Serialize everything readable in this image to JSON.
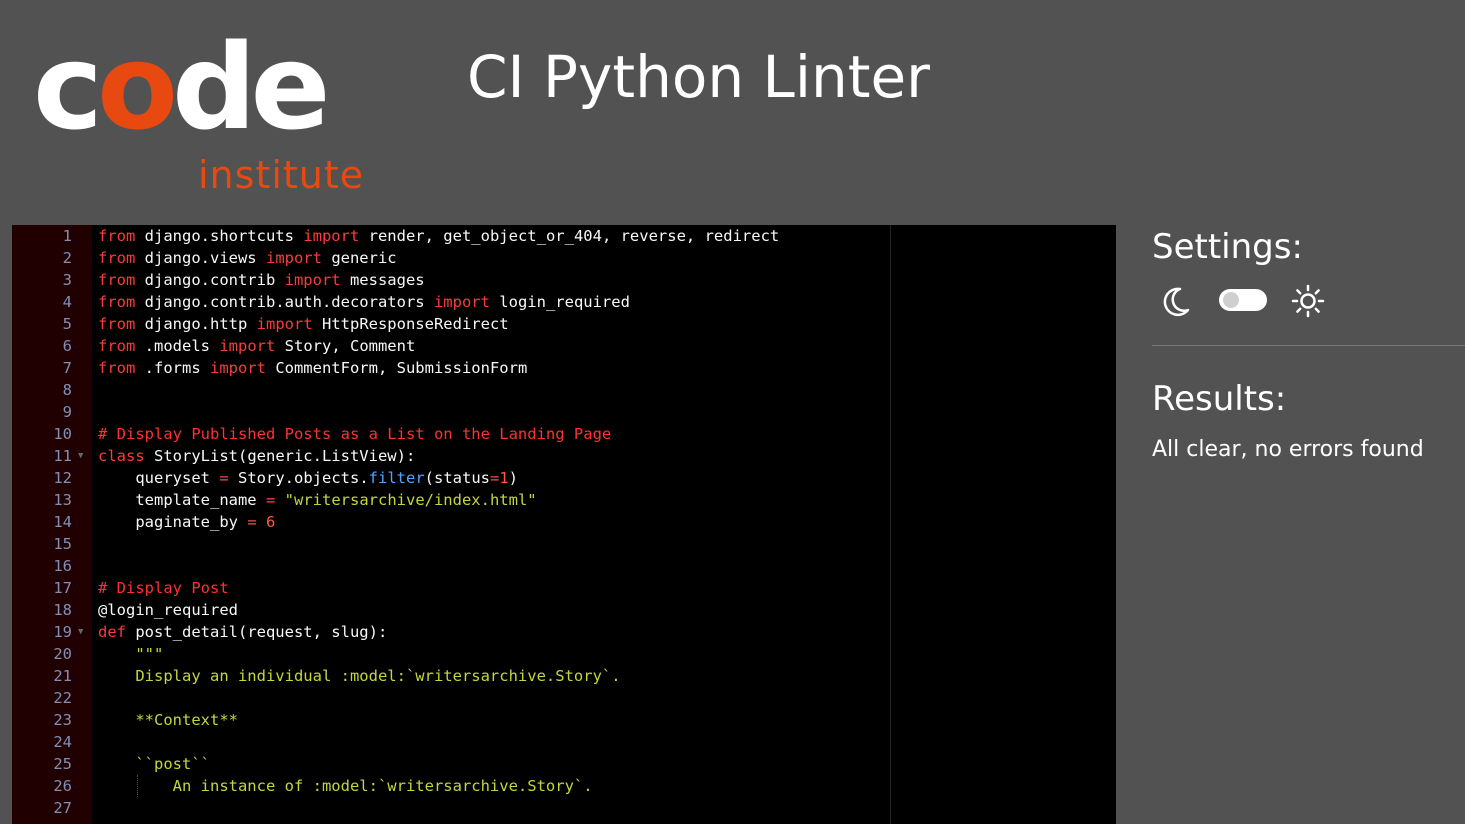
{
  "header": {
    "logo_word_c": "c",
    "logo_word_o": "o",
    "logo_word_de": "de",
    "logo_sub": "institute",
    "title": "CI Python Linter",
    "brand_orange": "#e84910"
  },
  "editor": {
    "lines": [
      {
        "n": "1",
        "fold": false,
        "tokens": [
          {
            "t": "kw",
            "v": "from"
          },
          {
            "t": "txt",
            "v": " django.shortcuts "
          },
          {
            "t": "kw",
            "v": "import"
          },
          {
            "t": "txt",
            "v": " render, get_object_or_404, reverse, redirect"
          }
        ]
      },
      {
        "n": "2",
        "fold": false,
        "tokens": [
          {
            "t": "kw",
            "v": "from"
          },
          {
            "t": "txt",
            "v": " django.views "
          },
          {
            "t": "kw",
            "v": "import"
          },
          {
            "t": "txt",
            "v": " generic"
          }
        ]
      },
      {
        "n": "3",
        "fold": false,
        "tokens": [
          {
            "t": "kw",
            "v": "from"
          },
          {
            "t": "txt",
            "v": " django.contrib "
          },
          {
            "t": "kw",
            "v": "import"
          },
          {
            "t": "txt",
            "v": " messages"
          }
        ]
      },
      {
        "n": "4",
        "fold": false,
        "tokens": [
          {
            "t": "kw",
            "v": "from"
          },
          {
            "t": "txt",
            "v": " django.contrib.auth.decorators "
          },
          {
            "t": "kw",
            "v": "import"
          },
          {
            "t": "txt",
            "v": " login_required"
          }
        ]
      },
      {
        "n": "5",
        "fold": false,
        "tokens": [
          {
            "t": "kw",
            "v": "from"
          },
          {
            "t": "txt",
            "v": " django.http "
          },
          {
            "t": "kw",
            "v": "import"
          },
          {
            "t": "txt",
            "v": " HttpResponseRedirect"
          }
        ]
      },
      {
        "n": "6",
        "fold": false,
        "tokens": [
          {
            "t": "kw",
            "v": "from"
          },
          {
            "t": "txt",
            "v": " .models "
          },
          {
            "t": "kw",
            "v": "import"
          },
          {
            "t": "txt",
            "v": " Story, Comment"
          }
        ]
      },
      {
        "n": "7",
        "fold": false,
        "tokens": [
          {
            "t": "kw",
            "v": "from"
          },
          {
            "t": "txt",
            "v": " .forms "
          },
          {
            "t": "kw",
            "v": "import"
          },
          {
            "t": "txt",
            "v": " CommentForm, SubmissionForm"
          }
        ]
      },
      {
        "n": "8",
        "fold": false,
        "tokens": []
      },
      {
        "n": "9",
        "fold": false,
        "tokens": []
      },
      {
        "n": "10",
        "fold": false,
        "tokens": [
          {
            "t": "cm",
            "v": "# Display Published Posts as a List on the Landing Page"
          }
        ]
      },
      {
        "n": "11",
        "fold": true,
        "tokens": [
          {
            "t": "kw",
            "v": "class"
          },
          {
            "t": "txt",
            "v": " StoryList(generic.ListView):"
          }
        ]
      },
      {
        "n": "12",
        "fold": false,
        "tokens": [
          {
            "t": "txt",
            "v": "    queryset "
          },
          {
            "t": "op",
            "v": "="
          },
          {
            "t": "txt",
            "v": " Story.objects."
          },
          {
            "t": "fn",
            "v": "filter"
          },
          {
            "t": "txt",
            "v": "(status"
          },
          {
            "t": "op",
            "v": "="
          },
          {
            "t": "num",
            "v": "1"
          },
          {
            "t": "txt",
            "v": ")"
          }
        ]
      },
      {
        "n": "13",
        "fold": false,
        "tokens": [
          {
            "t": "txt",
            "v": "    template_name "
          },
          {
            "t": "op",
            "v": "="
          },
          {
            "t": "txt",
            "v": " "
          },
          {
            "t": "str",
            "v": "\"writersarchive/index.html\""
          }
        ]
      },
      {
        "n": "14",
        "fold": false,
        "tokens": [
          {
            "t": "txt",
            "v": "    paginate_by "
          },
          {
            "t": "op",
            "v": "="
          },
          {
            "t": "txt",
            "v": " "
          },
          {
            "t": "num",
            "v": "6"
          }
        ]
      },
      {
        "n": "15",
        "fold": false,
        "tokens": []
      },
      {
        "n": "16",
        "fold": false,
        "tokens": []
      },
      {
        "n": "17",
        "fold": false,
        "tokens": [
          {
            "t": "cm",
            "v": "# Display Post"
          }
        ]
      },
      {
        "n": "18",
        "fold": false,
        "tokens": [
          {
            "t": "txt",
            "v": "@login_required"
          }
        ]
      },
      {
        "n": "19",
        "fold": true,
        "tokens": [
          {
            "t": "kw",
            "v": "def"
          },
          {
            "t": "txt",
            "v": " post_detail(request, slug):"
          }
        ]
      },
      {
        "n": "20",
        "fold": false,
        "tokens": [
          {
            "t": "str",
            "v": "    \"\"\""
          }
        ]
      },
      {
        "n": "21",
        "fold": false,
        "tokens": [
          {
            "t": "str",
            "v": "    Display an individual :model:`writersarchive.Story`."
          }
        ]
      },
      {
        "n": "22",
        "fold": false,
        "tokens": []
      },
      {
        "n": "23",
        "fold": false,
        "tokens": [
          {
            "t": "str",
            "v": "    **Context**"
          }
        ]
      },
      {
        "n": "24",
        "fold": false,
        "tokens": []
      },
      {
        "n": "25",
        "fold": false,
        "tokens": [
          {
            "t": "str",
            "v": "    ``post``"
          }
        ]
      },
      {
        "n": "26",
        "fold": false,
        "tokens": [
          {
            "t": "str",
            "v": "        An instance of :model:`writersarchive.Story`."
          }
        ]
      },
      {
        "n": "27",
        "fold": false,
        "tokens": []
      }
    ]
  },
  "sidebar": {
    "settings_label": "Settings:",
    "moon_icon": "moon-icon",
    "sun_icon": "sun-icon",
    "toggle_checked": false,
    "results_label": "Results:",
    "results_text": "All clear, no errors found"
  }
}
